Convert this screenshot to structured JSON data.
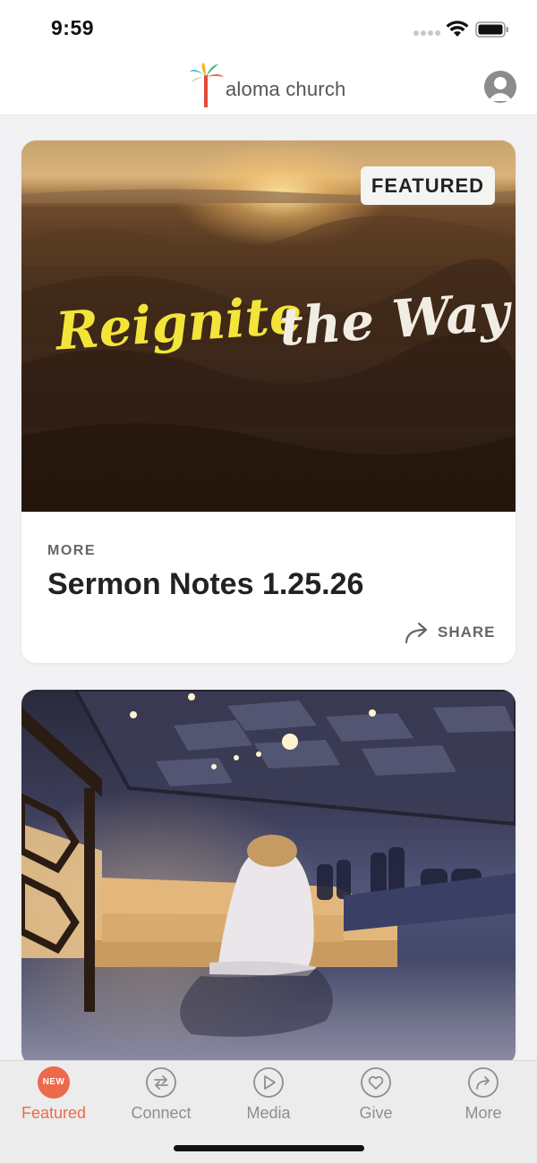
{
  "status_bar": {
    "time": "9:59"
  },
  "header": {
    "logo_text": "aloma church",
    "logo_icon": "palm-tree-icon",
    "profile_icon": "user-avatar-icon"
  },
  "cards": [
    {
      "badge": "FEATURED",
      "artwork_words": [
        "Reignite",
        "the Way"
      ],
      "category": "MORE",
      "title": "Sermon Notes 1.25.26",
      "share_label": "SHARE"
    },
    {
      "image_desc": "worship-room"
    }
  ],
  "tabbar": {
    "tabs": [
      {
        "label": "Featured",
        "icon": "new-badge-icon",
        "badge": "NEW",
        "active": true
      },
      {
        "label": "Connect",
        "icon": "swap-arrows-icon",
        "active": false
      },
      {
        "label": "Media",
        "icon": "play-icon",
        "active": false
      },
      {
        "label": "Give",
        "icon": "heart-icon",
        "active": false
      },
      {
        "label": "More",
        "icon": "forward-arrow-icon",
        "active": false
      }
    ]
  },
  "colors": {
    "accent": "#ec6a4c",
    "inactive": "#8e8e93",
    "background": "#f2f2f4"
  }
}
